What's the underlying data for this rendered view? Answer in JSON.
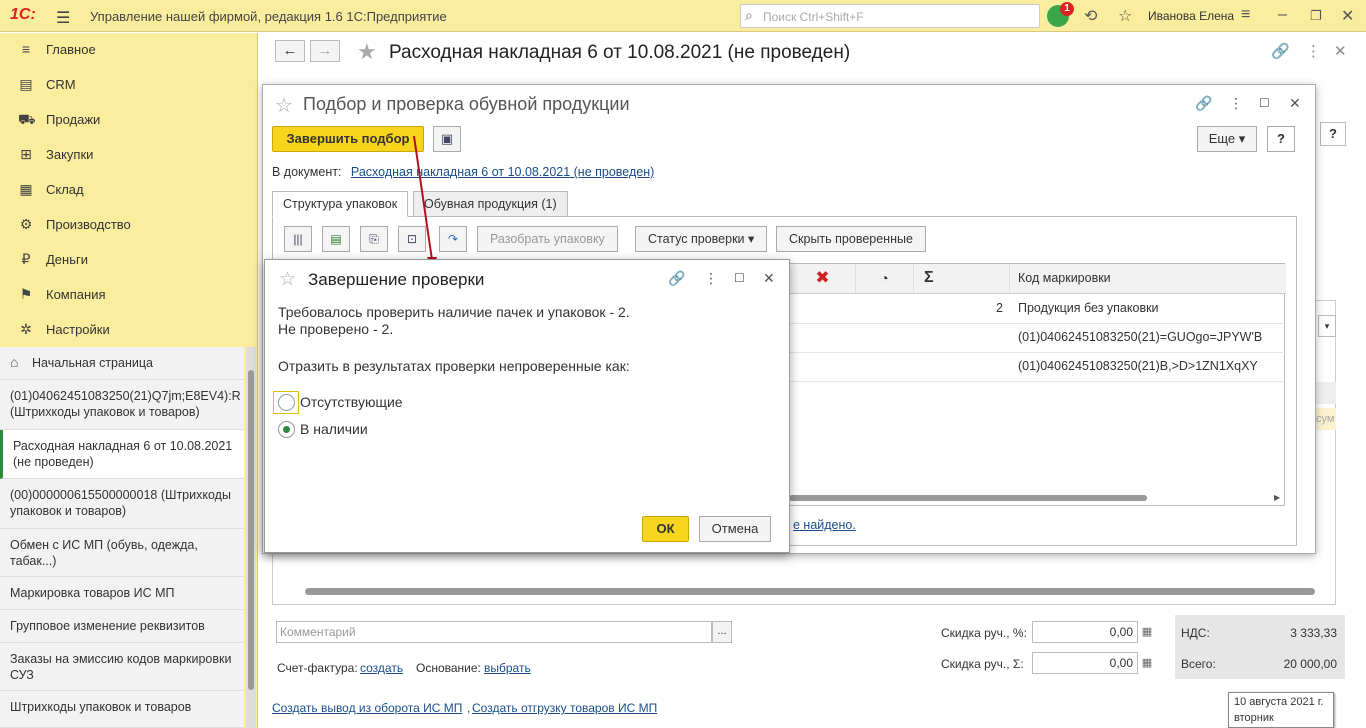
{
  "app": {
    "logo": "1С:",
    "title": "Управление нашей фирмой, редакция 1.6 1С:Предприятие",
    "search_placeholder": "Поиск Ctrl+Shift+F",
    "notifications_count": "1",
    "user": "Иванова Елена"
  },
  "sidebar": {
    "items": [
      {
        "label": "Главное",
        "icon": "menu-icon"
      },
      {
        "label": "CRM",
        "icon": "crm-icon"
      },
      {
        "label": "Продажи",
        "icon": "basket-icon"
      },
      {
        "label": "Закупки",
        "icon": "cart-icon"
      },
      {
        "label": "Склад",
        "icon": "warehouse-icon"
      },
      {
        "label": "Производство",
        "icon": "production-icon"
      },
      {
        "label": "Деньги",
        "icon": "money-icon"
      },
      {
        "label": "Компания",
        "icon": "flag-icon"
      },
      {
        "label": "Настройки",
        "icon": "gear-icon"
      }
    ],
    "open_windows": [
      {
        "label": "Начальная страница"
      },
      {
        "label": "(01)04062451083250(21)Q7jm;E8EV4):R (Штрихкоды упаковок и товаров)"
      },
      {
        "label": "Расходная накладная 6 от 10.08.2021 (не проведен)"
      },
      {
        "label": "(00)000000615500000018 (Штрихкоды упаковок и товаров)"
      },
      {
        "label": "Обмен с ИС МП (обувь, одежда, табак...)"
      },
      {
        "label": "Маркировка товаров ИС МП"
      },
      {
        "label": "Групповое изменение реквизитов"
      },
      {
        "label": "Заказы на эмиссию кодов маркировки СУЗ"
      },
      {
        "label": "Штрихкоды упаковок и товаров"
      }
    ]
  },
  "main": {
    "title": "Расходная накладная 6 от 10.08.2021 (не проведен)",
    "comment_placeholder": "Комментарий",
    "invoice_label": "Счет-фактура:",
    "invoice_link": "создать",
    "basis_label": "Основание:",
    "basis_link": "выбрать",
    "discount_pct_label": "Скидка руч., %:",
    "discount_pct_value": "0,00",
    "discount_sum_label": "Скидка руч., Σ:",
    "discount_sum_value": "0,00",
    "vat_label": "НДС:",
    "vat_value": "3 333,33",
    "total_label": "Всего:",
    "total_value": "20 000,00",
    "link1": "Создать вывод из оборота ИС МП",
    "link2": "Создать отгрузку товаров ИС МП",
    "sum_hint": "сум",
    "date_line1": "10 августа 2021 г.",
    "date_line2": "вторник"
  },
  "picker": {
    "title": "Подбор и проверка обувной продукции",
    "finish_button": "Завершить подбор",
    "more_button": "Еще",
    "help": "?",
    "doc_label": "В документ:",
    "doc_link": "Расходная накладная 6 от 10.08.2021 (не проведен)",
    "tabs": [
      "Структура упаковок",
      "Обувная продукция (1)"
    ],
    "unpack_button": "Разобрать упаковку",
    "status_button": "Статус проверки",
    "hide_button": "Скрыть проверенные",
    "grid_header_code": "Код маркировки",
    "rows": [
      {
        "count": "2",
        "code": "Продукция без упаковки"
      },
      {
        "count": "",
        "code": "(01)04062451083250(21)=GUOgo=JPYW'B"
      },
      {
        "count": "",
        "code": "(01)04062451083250(21)B,>D>1ZN1XqXY"
      }
    ],
    "not_found_link": "е найдено."
  },
  "dialog": {
    "title": "Завершение проверки",
    "line1": "Требовалось проверить наличие пачек и упаковок - 2.",
    "line2": "Не проверено - 2.",
    "question": "Отразить в результатах проверки непроверенные как:",
    "option1": "Отсутствующие",
    "option2": "В наличии",
    "selected": "В наличии",
    "ok": "ОК",
    "cancel": "Отмена"
  },
  "colors": {
    "sidebar_bg": "#fbed9e",
    "accent_yellow": "#f7d51c",
    "link": "#1a4f8c",
    "active_green": "#2c8a3e",
    "arrow": "#b01020"
  }
}
